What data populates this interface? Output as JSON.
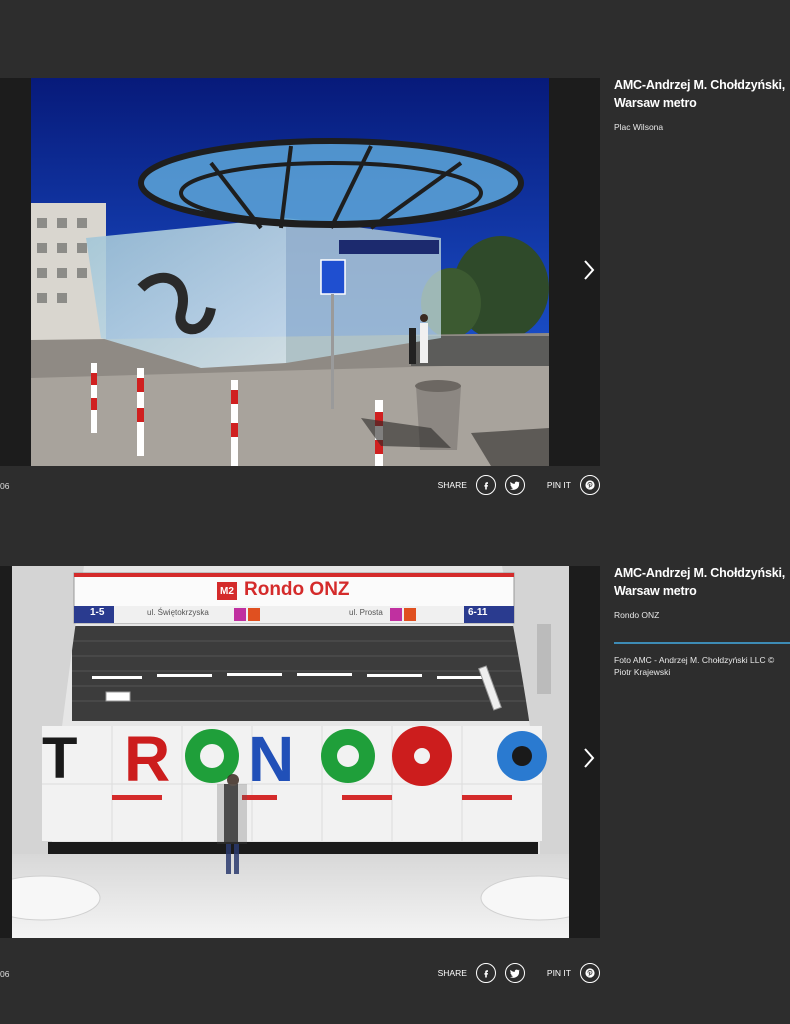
{
  "items": [
    {
      "title": "AMC-Andrzej M. Chołdzyński, Warsaw metro",
      "subtitle": "Plac Wilsona",
      "counter": "06",
      "share_label": "SHARE",
      "pin_label": "PIN IT",
      "icons": [
        "facebook-icon",
        "twitter-icon",
        "pinterest-icon",
        "chevron-right-icon"
      ]
    },
    {
      "title": "AMC-Andrzej M. Chołdzyński, Warsaw metro",
      "subtitle": "Rondo ONZ",
      "credit": "Foto AMC - Andrzej M. Chołdzyński LLC © Piotr Krajewski",
      "counter": "06",
      "share_label": "SHARE",
      "pin_label": "PIN IT",
      "sign": {
        "line": "M2",
        "station": "Rondo ONZ",
        "left_exits": "1-5",
        "left_street": "ul. Świętokrzyska",
        "right_street": "ul. Prosta",
        "right_exits": "6-11"
      },
      "wall_text": "RONDO"
    }
  ],
  "colors": {
    "background": "#2d2d2d",
    "accent": "#3d8bb5",
    "sign_red": "#d42b2b",
    "sign_blue": "#2a3b8f"
  }
}
